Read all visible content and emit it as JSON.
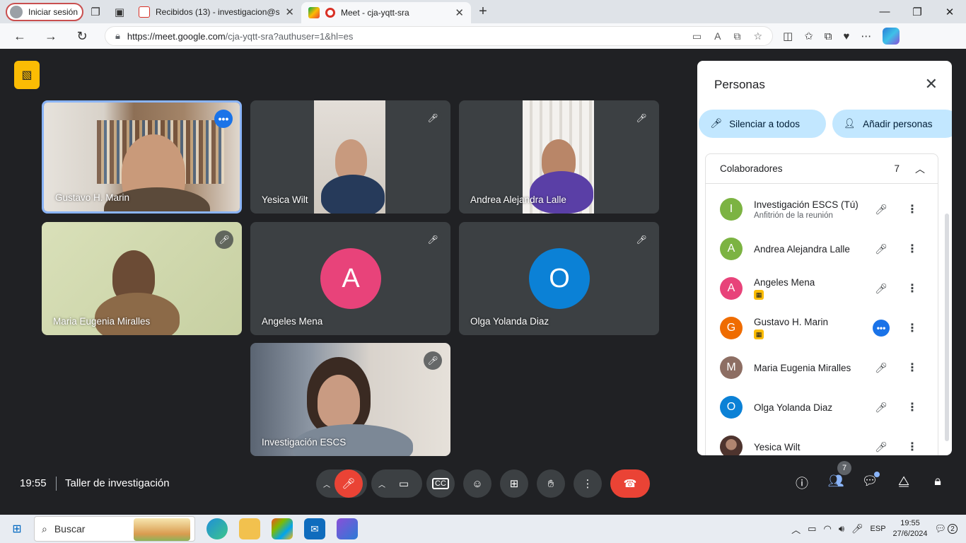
{
  "browser": {
    "profile_label": "Iniciar sesión",
    "tabs": [
      {
        "title": "Recibidos (13) - investigacion@s",
        "active": false
      },
      {
        "title": "Meet - cja-yqtt-sra",
        "active": true
      }
    ],
    "new_tab": "+",
    "url_domain": "https://meet.google.com",
    "url_path": "/cja-yqtt-sra?authuser=1&hl=es"
  },
  "meet": {
    "tiles": [
      {
        "name": "Gustavo H. Marin"
      },
      {
        "name": "Yesica Wilt"
      },
      {
        "name": "Andrea Alejandra Lalle"
      },
      {
        "name": "Maria Eugenia Miralles"
      },
      {
        "name": "Angeles Mena",
        "initial": "A",
        "color": "#e8437a"
      },
      {
        "name": "Olga Yolanda Diaz",
        "initial": "O",
        "color": "#0b81d6"
      },
      {
        "name": "Investigación ESCS"
      }
    ],
    "clock": "19:55",
    "meeting_title": "Taller de investigación",
    "participant_count": "7"
  },
  "panel": {
    "title": "Personas",
    "mute_all": "Silenciar a todos",
    "add_people": "Añadir personas",
    "group_label": "Colaboradores",
    "group_count": "7",
    "participants": [
      {
        "initial": "I",
        "name": "Investigación ESCS (Tú)",
        "sub": "Anfitrión de la reunión",
        "color": "#7cb342"
      },
      {
        "initial": "A",
        "name": "Andrea Alejandra Lalle",
        "color": "#7cb342"
      },
      {
        "initial": "A",
        "name": "Angeles Mena",
        "color": "#e8437a"
      },
      {
        "initial": "G",
        "name": "Gustavo H. Marin",
        "color": "#ef6c00"
      },
      {
        "initial": "M",
        "name": "Maria Eugenia Miralles",
        "color": "#8d6e63"
      },
      {
        "initial": "O",
        "name": "Olga Yolanda Diaz",
        "color": "#0b81d6"
      },
      {
        "initial": "",
        "name": "Yesica Wilt",
        "color": "#5d4037"
      }
    ]
  },
  "taskbar": {
    "search_placeholder": "Buscar",
    "language": "ESP",
    "time": "19:55",
    "date": "27/6/2024",
    "notifications": "2"
  }
}
